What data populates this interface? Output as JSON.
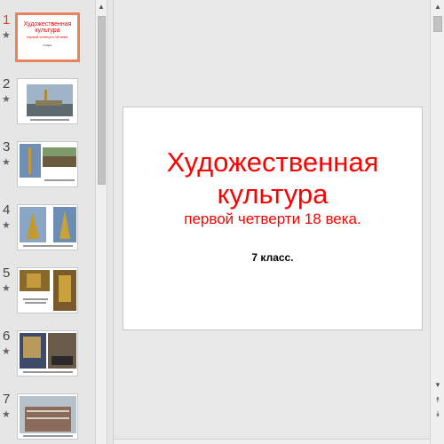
{
  "thumbnails": [
    {
      "number": "1",
      "star": "★",
      "active": true,
      "title": "Художественная культура",
      "subtitle": "первой четверти 18 века.",
      "class": "7 класс."
    },
    {
      "number": "2",
      "star": "★"
    },
    {
      "number": "3",
      "star": "★"
    },
    {
      "number": "4",
      "star": "★"
    },
    {
      "number": "5",
      "star": "★"
    },
    {
      "number": "6",
      "star": "★"
    },
    {
      "number": "7",
      "star": "★"
    }
  ],
  "slide": {
    "title_line1": "Художественная",
    "title_line2": "культура",
    "subtitle": "первой четверти 18 века.",
    "class_label": "7 класс."
  },
  "icons": {
    "scroll_up": "▲",
    "scroll_down": "▼",
    "prev_slide": "⯭",
    "next_slide": "⯯"
  },
  "colors": {
    "title_red": "#ff0000",
    "active_thumb_border": "#e8825f",
    "active_number": "#d24726"
  }
}
